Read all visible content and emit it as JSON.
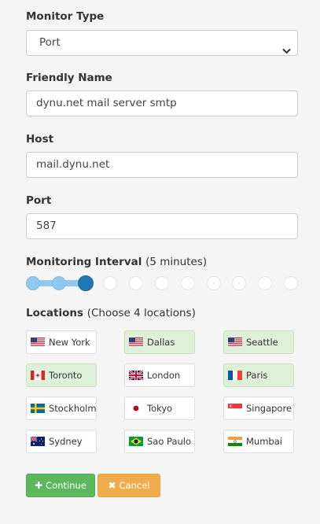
{
  "monitor_type": {
    "label": "Monitor Type",
    "value": "Port"
  },
  "friendly_name": {
    "label": "Friendly Name",
    "value": "dynu.net mail server smtp"
  },
  "host": {
    "label": "Host",
    "value": "mail.dynu.net"
  },
  "port": {
    "label": "Port",
    "value": "587"
  },
  "interval": {
    "label": "Monitoring Interval",
    "note": "(5 minutes)",
    "selected_step": 3,
    "total_steps": 11
  },
  "locations": {
    "label": "Locations",
    "note": "(Choose 4 locations)",
    "items": [
      {
        "name": "New York",
        "flag": "us-flag-icon",
        "selected": false
      },
      {
        "name": "Dallas",
        "flag": "us-flag-icon",
        "selected": true
      },
      {
        "name": "Seattle",
        "flag": "us-flag-icon",
        "selected": true
      },
      {
        "name": "Toronto",
        "flag": "canada-flag-icon",
        "selected": true
      },
      {
        "name": "London",
        "flag": "uk-flag-icon",
        "selected": false
      },
      {
        "name": "Paris",
        "flag": "france-flag-icon",
        "selected": true
      },
      {
        "name": "Stockholm",
        "flag": "sweden-flag-icon",
        "selected": false
      },
      {
        "name": "Tokyo",
        "flag": "japan-flag-icon",
        "selected": false
      },
      {
        "name": "Singapore",
        "flag": "singapore-flag-icon",
        "selected": false
      },
      {
        "name": "Sydney",
        "flag": "australia-flag-icon",
        "selected": false
      },
      {
        "name": "Sao Paulo",
        "flag": "brazil-flag-icon",
        "selected": false
      },
      {
        "name": "Mumbai",
        "flag": "india-flag-icon",
        "selected": false
      }
    ]
  },
  "buttons": {
    "continue": "Continue",
    "cancel": "Cancel"
  },
  "colors": {
    "selected_bg": "#dff0d8",
    "continue": "#5cb85c",
    "cancel": "#f0ad4e",
    "slider": "#1f78b4"
  }
}
